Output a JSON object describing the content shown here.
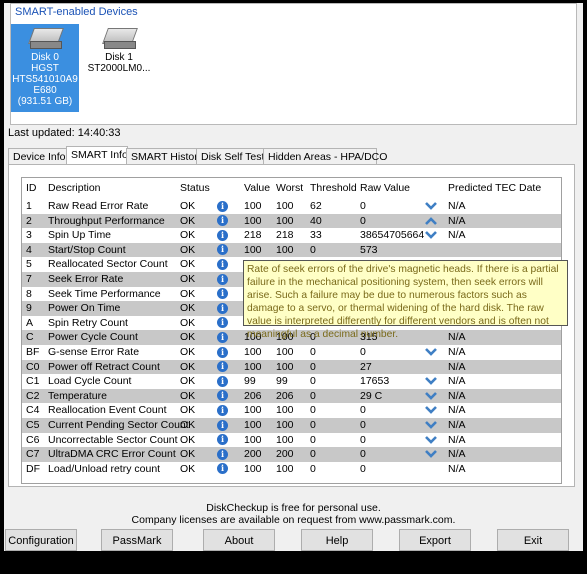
{
  "devices": {
    "title": "SMART-enabled Devices",
    "disks": [
      {
        "lines": [
          "Disk 0",
          "HGST",
          "HTS541010A9",
          "E680",
          "(931.51 GB)"
        ],
        "selected": true
      },
      {
        "lines": [
          "Disk 1",
          "ST2000LM0..."
        ],
        "selected": false
      }
    ]
  },
  "last_updated": "Last updated: 14:40:33",
  "tabs": [
    "Device Info",
    "SMART Info",
    "SMART History",
    "Disk Self Test",
    "Hidden Areas - HPA/DCO"
  ],
  "active_tab": "SMART Info",
  "table": {
    "headers": [
      "ID",
      "Description",
      "Status",
      "",
      "Value",
      "Worst",
      "Threshold",
      "Raw Value",
      "",
      "Predicted TEC Date"
    ],
    "rows": [
      {
        "id": "1",
        "desc": "Raw Read Error Rate",
        "status": "OK",
        "value": "100",
        "worst": "100",
        "threshold": "62",
        "raw": "0",
        "trend": "down",
        "tec": "N/A"
      },
      {
        "id": "2",
        "desc": "Throughput Performance",
        "status": "OK",
        "value": "100",
        "worst": "100",
        "threshold": "40",
        "raw": "0",
        "trend": "up",
        "tec": "N/A"
      },
      {
        "id": "3",
        "desc": "Spin Up Time",
        "status": "OK",
        "value": "218",
        "worst": "218",
        "threshold": "33",
        "raw": "38654705664",
        "trend": "down",
        "tec": "N/A"
      },
      {
        "id": "4",
        "desc": "Start/Stop Count",
        "status": "OK",
        "value": "100",
        "worst": "100",
        "threshold": "0",
        "raw": "573",
        "trend": "",
        "tec": ""
      },
      {
        "id": "5",
        "desc": "Reallocated Sector Count",
        "status": "OK",
        "value": "",
        "worst": "",
        "threshold": "",
        "raw": "",
        "trend": "",
        "tec": ""
      },
      {
        "id": "7",
        "desc": "Seek Error Rate",
        "status": "OK",
        "value": "",
        "worst": "",
        "threshold": "",
        "raw": "",
        "trend": "",
        "tec": ""
      },
      {
        "id": "8",
        "desc": "Seek Time Performance",
        "status": "OK",
        "value": "",
        "worst": "",
        "threshold": "",
        "raw": "",
        "trend": "",
        "tec": ""
      },
      {
        "id": "9",
        "desc": "Power On Time",
        "status": "OK",
        "value": "",
        "worst": "",
        "threshold": "",
        "raw": "",
        "trend": "",
        "tec": ""
      },
      {
        "id": "A",
        "desc": "Spin Retry Count",
        "status": "OK",
        "value": "",
        "worst": "",
        "threshold": "",
        "raw": "",
        "trend": "",
        "tec": ""
      },
      {
        "id": "C",
        "desc": "Power Cycle Count",
        "status": "OK",
        "value": "100",
        "worst": "100",
        "threshold": "0",
        "raw": "315",
        "trend": "",
        "tec": "N/A"
      },
      {
        "id": "BF",
        "desc": "G-sense Error Rate",
        "status": "OK",
        "value": "100",
        "worst": "100",
        "threshold": "0",
        "raw": "0",
        "trend": "down",
        "tec": "N/A"
      },
      {
        "id": "C0",
        "desc": "Power off Retract Count",
        "status": "OK",
        "value": "100",
        "worst": "100",
        "threshold": "0",
        "raw": "27",
        "trend": "",
        "tec": "N/A"
      },
      {
        "id": "C1",
        "desc": "Load Cycle Count",
        "status": "OK",
        "value": "99",
        "worst": "99",
        "threshold": "0",
        "raw": "17653",
        "trend": "down",
        "tec": "N/A"
      },
      {
        "id": "C2",
        "desc": "Temperature",
        "status": "OK",
        "value": "206",
        "worst": "206",
        "threshold": "0",
        "raw": "29 C",
        "trend": "down",
        "tec": "N/A"
      },
      {
        "id": "C4",
        "desc": "Reallocation Event Count",
        "status": "OK",
        "value": "100",
        "worst": "100",
        "threshold": "0",
        "raw": "0",
        "trend": "down",
        "tec": "N/A"
      },
      {
        "id": "C5",
        "desc": "Current Pending Sector Count",
        "status": "OK",
        "value": "100",
        "worst": "100",
        "threshold": "0",
        "raw": "0",
        "trend": "down",
        "tec": "N/A"
      },
      {
        "id": "C6",
        "desc": "Uncorrectable Sector Count",
        "status": "OK",
        "value": "100",
        "worst": "100",
        "threshold": "0",
        "raw": "0",
        "trend": "down",
        "tec": "N/A"
      },
      {
        "id": "C7",
        "desc": "UltraDMA CRC Error Count",
        "status": "OK",
        "value": "200",
        "worst": "200",
        "threshold": "0",
        "raw": "0",
        "trend": "down",
        "tec": "N/A"
      },
      {
        "id": "DF",
        "desc": "Load/Unload retry count",
        "status": "OK",
        "value": "100",
        "worst": "100",
        "threshold": "0",
        "raw": "0",
        "trend": "",
        "tec": "N/A"
      }
    ]
  },
  "tooltip": "Rate of seek errors of the drive's magnetic heads. If there is a partial failure in the mechanical positioning system, then seek errors will arise. Such a failure may be due to numerous factors such as damage to a servo, or thermal widening of the hard disk. The raw value is interpreted differently for different vendors and is often not meaningful as a decimal number.",
  "footer": {
    "line1": "DiskCheckup is free for personal use.",
    "line2": "Company licenses are available on request from www.passmark.com."
  },
  "buttons": [
    "Configuration",
    "PassMark Home",
    "About",
    "Help",
    "Export",
    "Exit"
  ],
  "colors": {
    "selected_disk": "#3b8fe0",
    "info_icon": "#2a6fc9",
    "trend_arrow": "#3f7fc4",
    "tooltip_bg": "#ffffc6",
    "alt_row": "#c8c8c8"
  }
}
